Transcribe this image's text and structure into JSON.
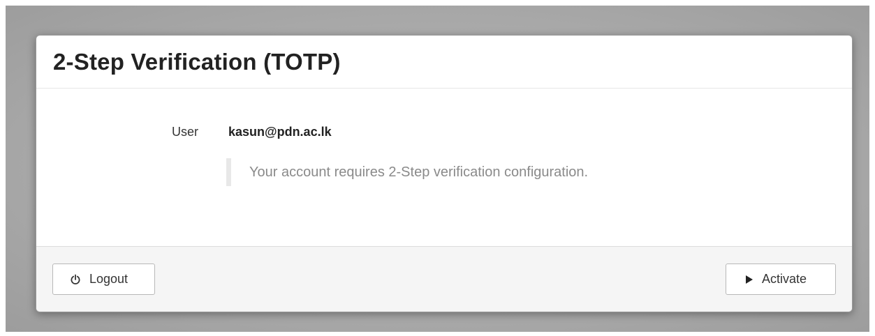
{
  "dialog": {
    "title": "2-Step Verification (TOTP)"
  },
  "user": {
    "label": "User",
    "email": "kasun@pdn.ac.lk"
  },
  "notice": {
    "text": "Your account requires 2-Step verification configuration."
  },
  "footer": {
    "logout_label": "Logout",
    "logout_icon": "power-icon",
    "activate_label": "Activate",
    "activate_icon": "play-icon"
  },
  "colors": {
    "backdrop": "#a9a9a9",
    "panel": "#ffffff",
    "footer": "#f5f5f5",
    "notice_text": "#8a8a8a",
    "notice_bar": "#e8e8e8"
  }
}
